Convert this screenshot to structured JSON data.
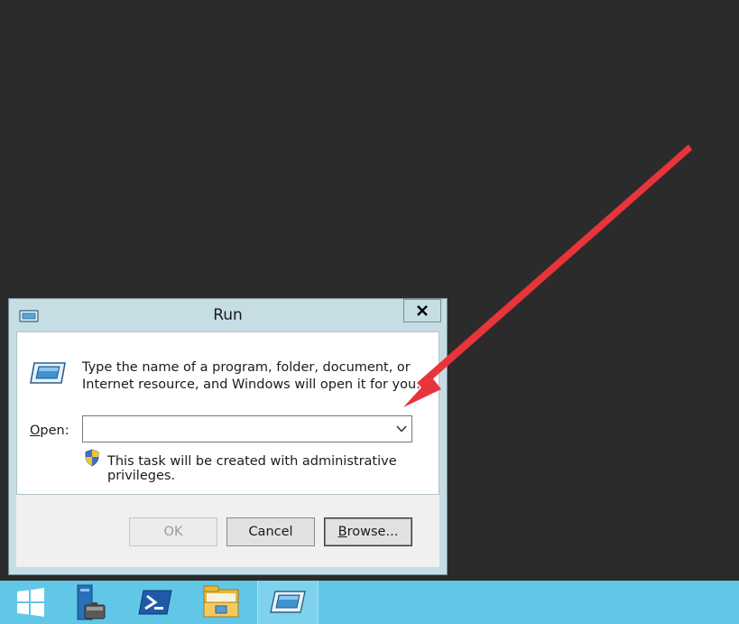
{
  "dialog": {
    "title": "Run",
    "close_label": "X",
    "description": "Type the name of a program, folder, document, or Internet resource, and Windows will open it for you.",
    "open_label_access": "O",
    "open_label_rest": "pen:",
    "open_value": "",
    "admin_notice": "This task will be created with administrative privileges.",
    "buttons": {
      "ok": "OK",
      "cancel": "Cancel",
      "browse_access": "B",
      "browse_rest": "rowse..."
    }
  },
  "taskbar": {
    "items": [
      {
        "icon": "windows-start-icon"
      },
      {
        "icon": "server-manager-icon"
      },
      {
        "icon": "powershell-icon"
      },
      {
        "icon": "file-explorer-icon"
      },
      {
        "icon": "run-icon",
        "active": true
      }
    ]
  },
  "colors": {
    "desktop": "#2b2b2b",
    "taskbar": "#61c7e6",
    "dialog_frame": "#c6dde4",
    "annotation_arrow": "#e8343b"
  }
}
